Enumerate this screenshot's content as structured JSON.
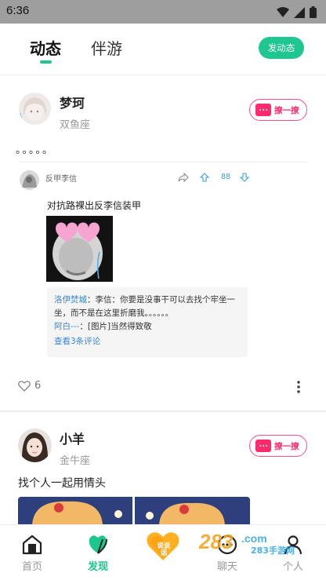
{
  "status_bar": {
    "time": "6:36"
  },
  "top_nav": {
    "tabs": [
      "动态",
      "伴游"
    ],
    "active_tab": "动态",
    "post_button": "发动态"
  },
  "posts": [
    {
      "name": "梦珂",
      "sign": "双鱼座",
      "flirt": "撩一撩",
      "text": "。。。。。",
      "share": {
        "user": "反甲李信",
        "count": "88",
        "text": "对抗路裸出反李信装甲",
        "comments": [
          {
            "author": "洛伊焚城",
            "sep": "：",
            "text": "李信：你要是没事干可以去找个牢坐一坐，而不是在这里折磨我。。。。。。"
          },
          {
            "author": "阿白---",
            "sep": "：",
            "text": "[图片]当然得致敬"
          }
        ],
        "more_comments": "查看3条评论"
      },
      "likes": "6"
    },
    {
      "name": "小羊",
      "sign": "金牛座",
      "flirt": "撩一撩",
      "text": "找个人一起用情头"
    }
  ],
  "bottom_nav": {
    "items": [
      {
        "label": "首页"
      },
      {
        "label": "发现"
      },
      {
        "label": "说说话"
      },
      {
        "label": "聊天"
      },
      {
        "label": "个人"
      }
    ],
    "active": "发现",
    "watermark": "283手游网"
  },
  "colors": {
    "accent": "#1ec690",
    "flirt": "#ff2b6e",
    "link": "#3a87d6"
  }
}
